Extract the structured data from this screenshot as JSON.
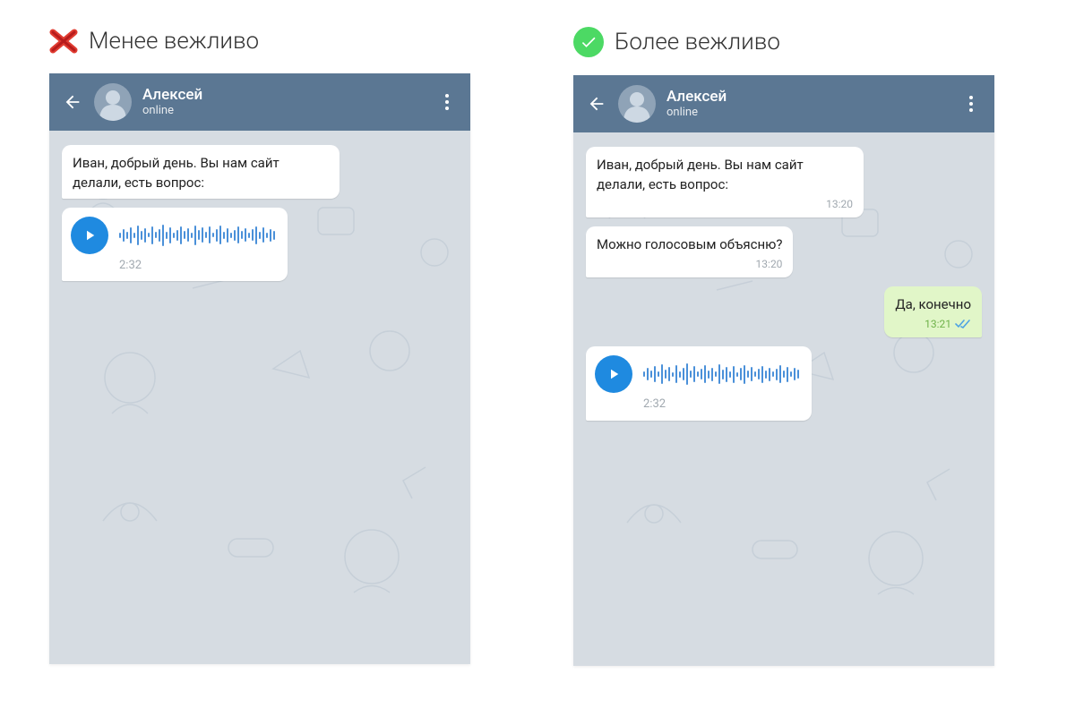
{
  "left": {
    "heading": "Менее вежливо",
    "contact_name": "Алексей",
    "contact_status": "online",
    "messages": [
      {
        "type": "text",
        "dir": "in",
        "text": "Иван, добрый день. Вы нам сайт делали, есть вопрос:"
      },
      {
        "type": "voice",
        "dir": "in",
        "duration": "2:32"
      }
    ]
  },
  "right": {
    "heading": "Более вежливо",
    "contact_name": "Алексей",
    "contact_status": "online",
    "messages": [
      {
        "type": "text",
        "dir": "in",
        "text": "Иван, добрый день. Вы нам сайт делали, есть вопрос:",
        "time": "13:20"
      },
      {
        "type": "text",
        "dir": "in",
        "text": "Можно голосовым объясню?",
        "time": "13:20"
      },
      {
        "type": "text",
        "dir": "out",
        "text": "Да, конечно",
        "time": "13:21",
        "ticks": true
      },
      {
        "type": "voice",
        "dir": "in",
        "duration": "2:32"
      }
    ]
  }
}
